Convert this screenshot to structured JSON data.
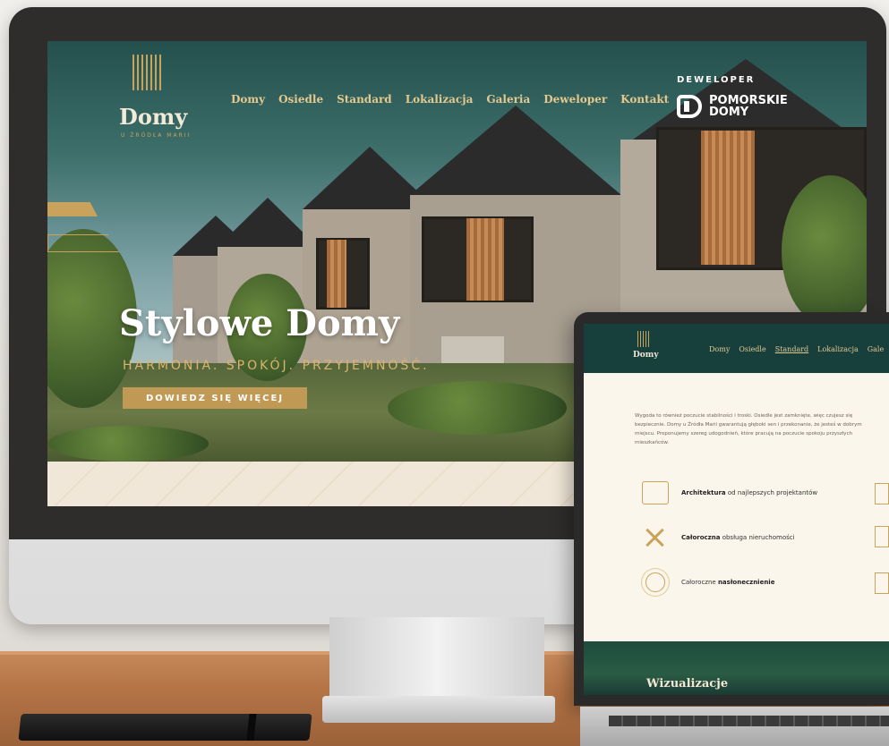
{
  "desktop_site": {
    "logo": {
      "name": "Domy",
      "tagline": "U ŹRÓDŁA MARII"
    },
    "nav": [
      "Domy",
      "Osiedle",
      "Standard",
      "Lokalizacja",
      "Galeria",
      "Deweloper",
      "Kontakt"
    ],
    "developer": {
      "label": "DEWELOPER",
      "name_line1": "POMORSKIE",
      "name_line2": "DOMY"
    },
    "hero": {
      "title": "Stylowe Domy",
      "subtitle": "HARMONIA. SPOKÓJ. PRZYJEMNOŚĆ.",
      "cta": "DOWIEDZ SIĘ WIĘCEJ"
    }
  },
  "laptop_site": {
    "logo": "Domy",
    "nav": [
      "Domy",
      "Osiedle",
      "Standard",
      "Lokalizacja",
      "Gale"
    ],
    "active_nav": "Standard",
    "paragraph": "Wygoda to również poczucie stabilności i troski. Osiedle jest zamknięte, więc czujesz się bezpiecznie. Domy u Źródła Marii gwarantują głęboki sen i przekonanie, że jesteś w dobrym miejscu. Proponujemy szereg udogodnień, które pracują na poczucie spokoju przyszłych mieszkańców.",
    "features": [
      {
        "bold": "Architektura",
        "rest": " od najlepszych projektantów",
        "icon": "blueprint-icon"
      },
      {
        "bold": "Całoroczna",
        "rest": " obsługa nieruchomości",
        "icon": "tools-icon"
      },
      {
        "pre": "Całoroczne ",
        "bold": "nasłonecznienie",
        "icon": "sun-icon"
      }
    ],
    "section_title": "Wizualizacje"
  },
  "colors": {
    "gold": "#c9a35b",
    "dark_green": "#173f3c",
    "cream": "#fbf6ec"
  }
}
